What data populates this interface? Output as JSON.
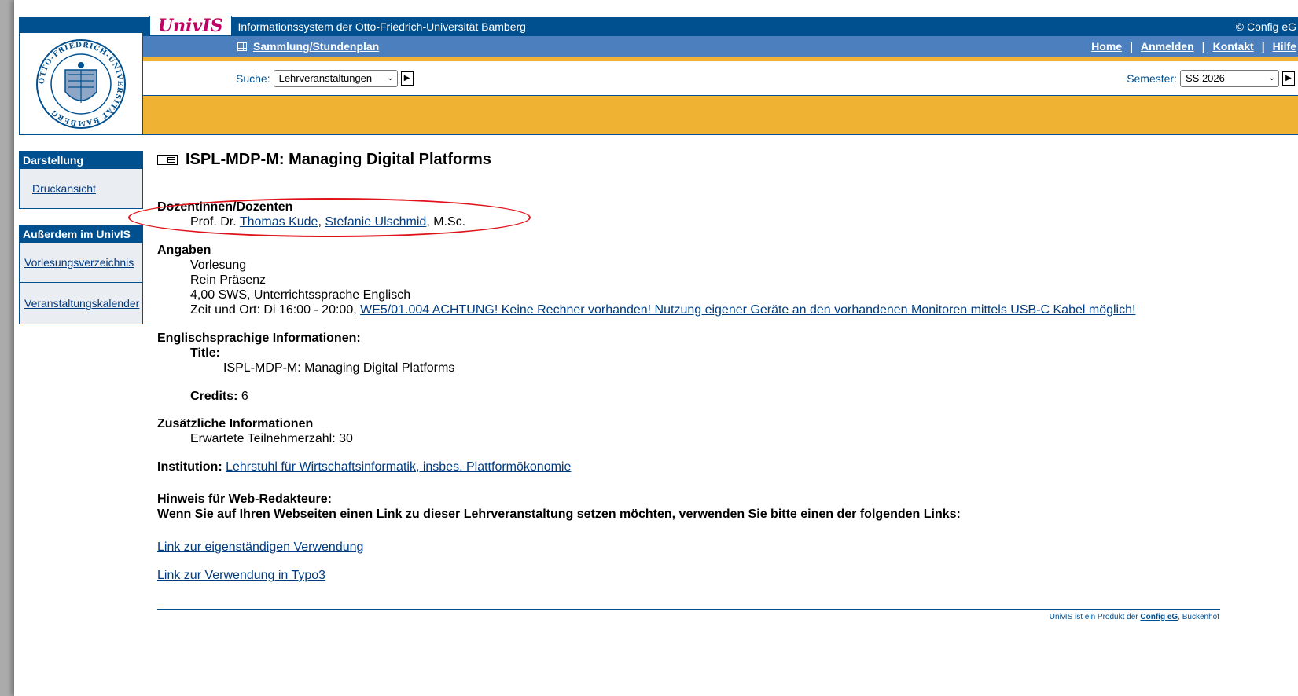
{
  "header": {
    "logo_text": "UnivIS",
    "seal_text": "OTTO-FRIEDRICH-UNIVERSITÄT BAMBERG",
    "title": "Informationssystem der Otto-Friedrich-Universität Bamberg",
    "copyright": "© Config eG"
  },
  "nav": {
    "collection_link": "Sammlung/Stundenplan",
    "links": [
      "Home",
      "Anmelden",
      "Kontakt",
      "Hilfe"
    ],
    "separator": "|"
  },
  "search": {
    "label": "Suche:",
    "selected": "Lehrveranstaltungen",
    "semester_label": "Semester:",
    "semester_selected": "SS 2026"
  },
  "sidebar": {
    "sections": [
      {
        "title": "Darstellung",
        "items": [
          "Druckansicht"
        ]
      },
      {
        "title": "Außerdem im UnivIS",
        "items": [
          "Vorlesungsverzeichnis",
          "Veranstaltungskalender"
        ]
      }
    ]
  },
  "course": {
    "title": "ISPL-MDP-M: Managing Digital Platforms",
    "lecturers_label": "Dozentinnen/Dozenten",
    "lecturer_prefix": "Prof. Dr.",
    "lecturer1": "Thomas Kude",
    "lecturer_sep": ",",
    "lecturer2": "Stefanie Ulschmid",
    "lecturer_suffix": ", M.Sc.",
    "details_label": "Angaben",
    "type": "Vorlesung",
    "mode": "Rein Präsenz",
    "sws": "4,00 SWS, Unterrichtssprache Englisch",
    "time_place_prefix": "Zeit und Ort: Di 16:00 - 20:00,",
    "room_link": "WE5/01.004 ACHTUNG! Keine Rechner vorhanden! Nutzung eigener Geräte an den vorhandenen Monitoren mittels USB-C Kabel möglich!",
    "english_label": "Englischsprachige Informationen:",
    "title_label": "Title:",
    "english_title": "ISPL-MDP-M: Managing Digital Platforms",
    "credits_label": "Credits:",
    "credits_value": "6",
    "extra_label": "Zusätzliche Informationen",
    "participants": "Erwartete Teilnehmerzahl: 30",
    "institution_label": "Institution:",
    "institution_link": "Lehrstuhl für Wirtschaftsinformatik, insbes. Plattformökonomie",
    "hint_label": "Hinweis für Web-Redakteure:",
    "hint_text": "Wenn Sie auf Ihren Webseiten einen Link zu dieser Lehrveranstaltung setzen möchten, verwenden Sie bitte einen der folgenden Links:",
    "link1": "Link zur eigenständigen Verwendung",
    "link2": "Link zur Verwendung in Typo3"
  },
  "footer": {
    "text": "UnivIS ist ein Produkt der",
    "link": "Config eG",
    "suffix": ", Buckenhof"
  }
}
